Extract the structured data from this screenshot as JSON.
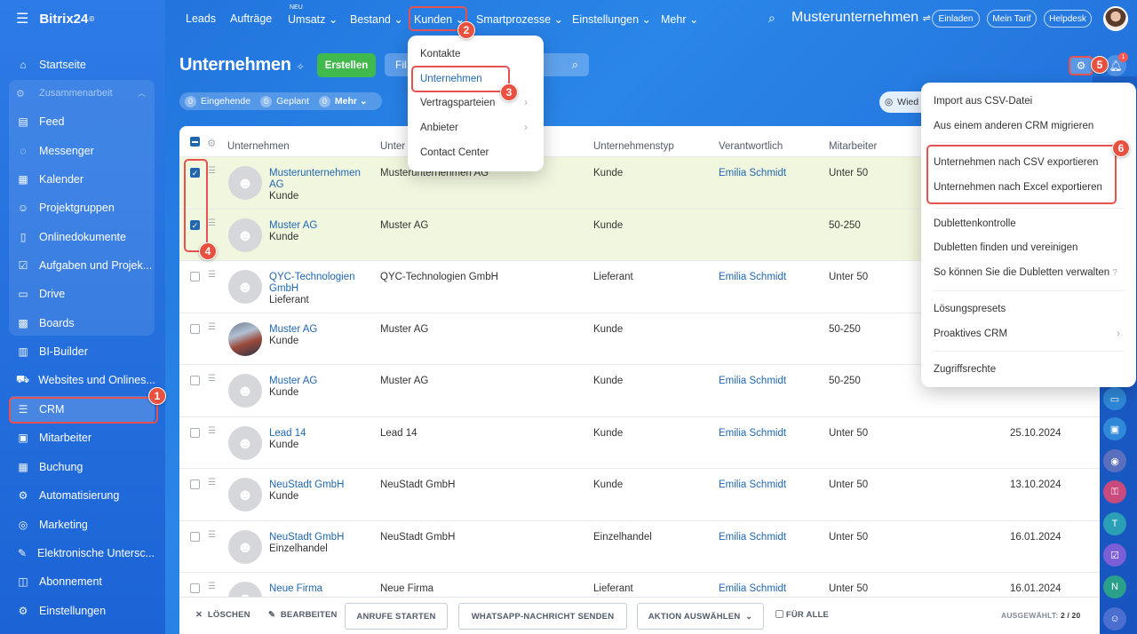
{
  "app": {
    "logo": "Bitrix24",
    "logo_suffix": "©"
  },
  "sidebar": {
    "items": [
      {
        "label": "Startseite",
        "icon": "home-icon"
      },
      {
        "label": "Zusammenarbeit",
        "icon": "collab-icon"
      },
      {
        "label": "Feed",
        "icon": "feed-icon"
      },
      {
        "label": "Messenger",
        "icon": "chat-icon"
      },
      {
        "label": "Kalender",
        "icon": "calendar-icon"
      },
      {
        "label": "Projektgruppen",
        "icon": "group-icon"
      },
      {
        "label": "Onlinedokumente",
        "icon": "document-icon"
      },
      {
        "label": "Aufgaben und Projek...",
        "icon": "task-icon"
      },
      {
        "label": "Drive",
        "icon": "drive-icon"
      },
      {
        "label": "Boards",
        "icon": "board-icon"
      },
      {
        "label": "BI-Builder",
        "icon": "chart-icon"
      },
      {
        "label": "Websites und Onlines...",
        "icon": "cart-icon"
      },
      {
        "label": "CRM",
        "icon": "crm-icon"
      },
      {
        "label": "Mitarbeiter",
        "icon": "employee-icon"
      },
      {
        "label": "Buchung",
        "icon": "booking-icon"
      },
      {
        "label": "Automatisierung",
        "icon": "automation-icon"
      },
      {
        "label": "Marketing",
        "icon": "marketing-icon"
      },
      {
        "label": "Elektronische Untersc...",
        "icon": "signature-icon"
      },
      {
        "label": "Abonnement",
        "icon": "subscription-icon"
      },
      {
        "label": "Einstellungen",
        "icon": "settings-icon"
      }
    ]
  },
  "topnav": {
    "items": [
      "Leads",
      "Aufträge",
      "Umsatz",
      "Bestand",
      "Kunden",
      "Smartprozesse",
      "Einstellungen",
      "Mehr"
    ],
    "neu_badge": "NEU",
    "company": "Musterunternehmen",
    "buttons": [
      "Einladen",
      "Mein Tarif",
      "Helpdesk"
    ]
  },
  "page": {
    "title": "Unternehmen",
    "create_button": "Erstellen",
    "filter_placeholder": "Fil",
    "counters": [
      {
        "count": "0",
        "label": "Eingehende"
      },
      {
        "count": "0",
        "label": "Geplant"
      },
      {
        "count": "0",
        "label": "Mehr"
      }
    ],
    "wied_label": "Wied",
    "notification_count": "1"
  },
  "table": {
    "headers": [
      "Unternehmen",
      "Unternehmen",
      "Unternehmenstyp",
      "Verantwortlich",
      "Mitarbeiter"
    ],
    "header_truncated": "Unter",
    "rows": [
      {
        "name": "Musterunternehmen AG",
        "sub": "Kunde",
        "company": "Musterunternehmen AG",
        "type": "Kunde",
        "resp": "Emilia Schmidt",
        "staff": "Unter 50",
        "date": "",
        "checked": true
      },
      {
        "name": "Muster AG",
        "sub": "Kunde",
        "company": "Muster AG",
        "type": "Kunde",
        "resp": "",
        "staff": "50-250",
        "date": "",
        "checked": true
      },
      {
        "name": "QYC-Technologien GmbH",
        "sub": "Lieferant",
        "company": "QYC-Technologien GmbH",
        "type": "Lieferant",
        "resp": "Emilia Schmidt",
        "staff": "Unter 50",
        "date": "",
        "checked": false
      },
      {
        "name": "Muster AG",
        "sub": "Kunde",
        "company": "Muster AG",
        "type": "Kunde",
        "resp": "",
        "staff": "50-250",
        "date": "",
        "checked": false
      },
      {
        "name": "Muster AG",
        "sub": "Kunde",
        "company": "Muster AG",
        "type": "Kunde",
        "resp": "Emilia Schmidt",
        "staff": "50-250",
        "date": "",
        "checked": false
      },
      {
        "name": "Lead 14",
        "sub": "Kunde",
        "company": "Lead 14",
        "type": "Kunde",
        "resp": "Emilia Schmidt",
        "staff": "Unter 50",
        "date": "25.10.2024",
        "checked": false
      },
      {
        "name": "NeuStadt GmbH",
        "sub": "Kunde",
        "company": "NeuStadt GmbH",
        "type": "Kunde",
        "resp": "Emilia Schmidt",
        "staff": "Unter 50",
        "date": "13.10.2024",
        "checked": false
      },
      {
        "name": "NeuStadt GmbH",
        "sub": "Einzelhandel",
        "company": "NeuStadt GmbH",
        "type": "Einzelhandel",
        "resp": "Emilia Schmidt",
        "staff": "Unter 50",
        "date": "16.01.2024",
        "checked": false
      },
      {
        "name": "Neue Firma",
        "sub": "",
        "company": "Neue Firma",
        "type": "Lieferant",
        "resp": "Emilia Schmidt",
        "staff": "Unter 50",
        "date": "16.01.2024",
        "checked": false
      }
    ]
  },
  "kunden_menu": {
    "items": [
      "Kontakte",
      "Unternehmen",
      "Vertragsparteien",
      "Anbieter",
      "Contact Center"
    ]
  },
  "settings_menu": {
    "items": [
      "Import aus CSV-Datei",
      "Aus einem anderen CRM migrieren",
      "Unternehmen nach CSV exportieren",
      "Unternehmen nach Excel exportieren",
      "Dublettenkontrolle",
      "Dubletten finden und vereinigen",
      "So können Sie die Dubletten verwalten",
      "Lösungspresets",
      "Proaktives CRM",
      "Zugriffsrechte"
    ]
  },
  "bottom_bar": {
    "delete": "LÖSCHEN",
    "edit": "BEARBEITEN",
    "calls": "ANRUFE STARTEN",
    "whatsapp": "WHATSAPP-NACHRICHT SENDEN",
    "action": "AKTION AUSWÄHLEN",
    "for_all": "FÜR ALLE",
    "selected_label": "AUSGEWÄHLT:",
    "selected_value": "2 / 20"
  },
  "steps": [
    "1",
    "2",
    "3",
    "4",
    "5",
    "6"
  ],
  "colors": {
    "accent": "#2067b0",
    "create": "#41b94d",
    "highlight": "#e65252",
    "selected_row": "#f1f7de"
  }
}
